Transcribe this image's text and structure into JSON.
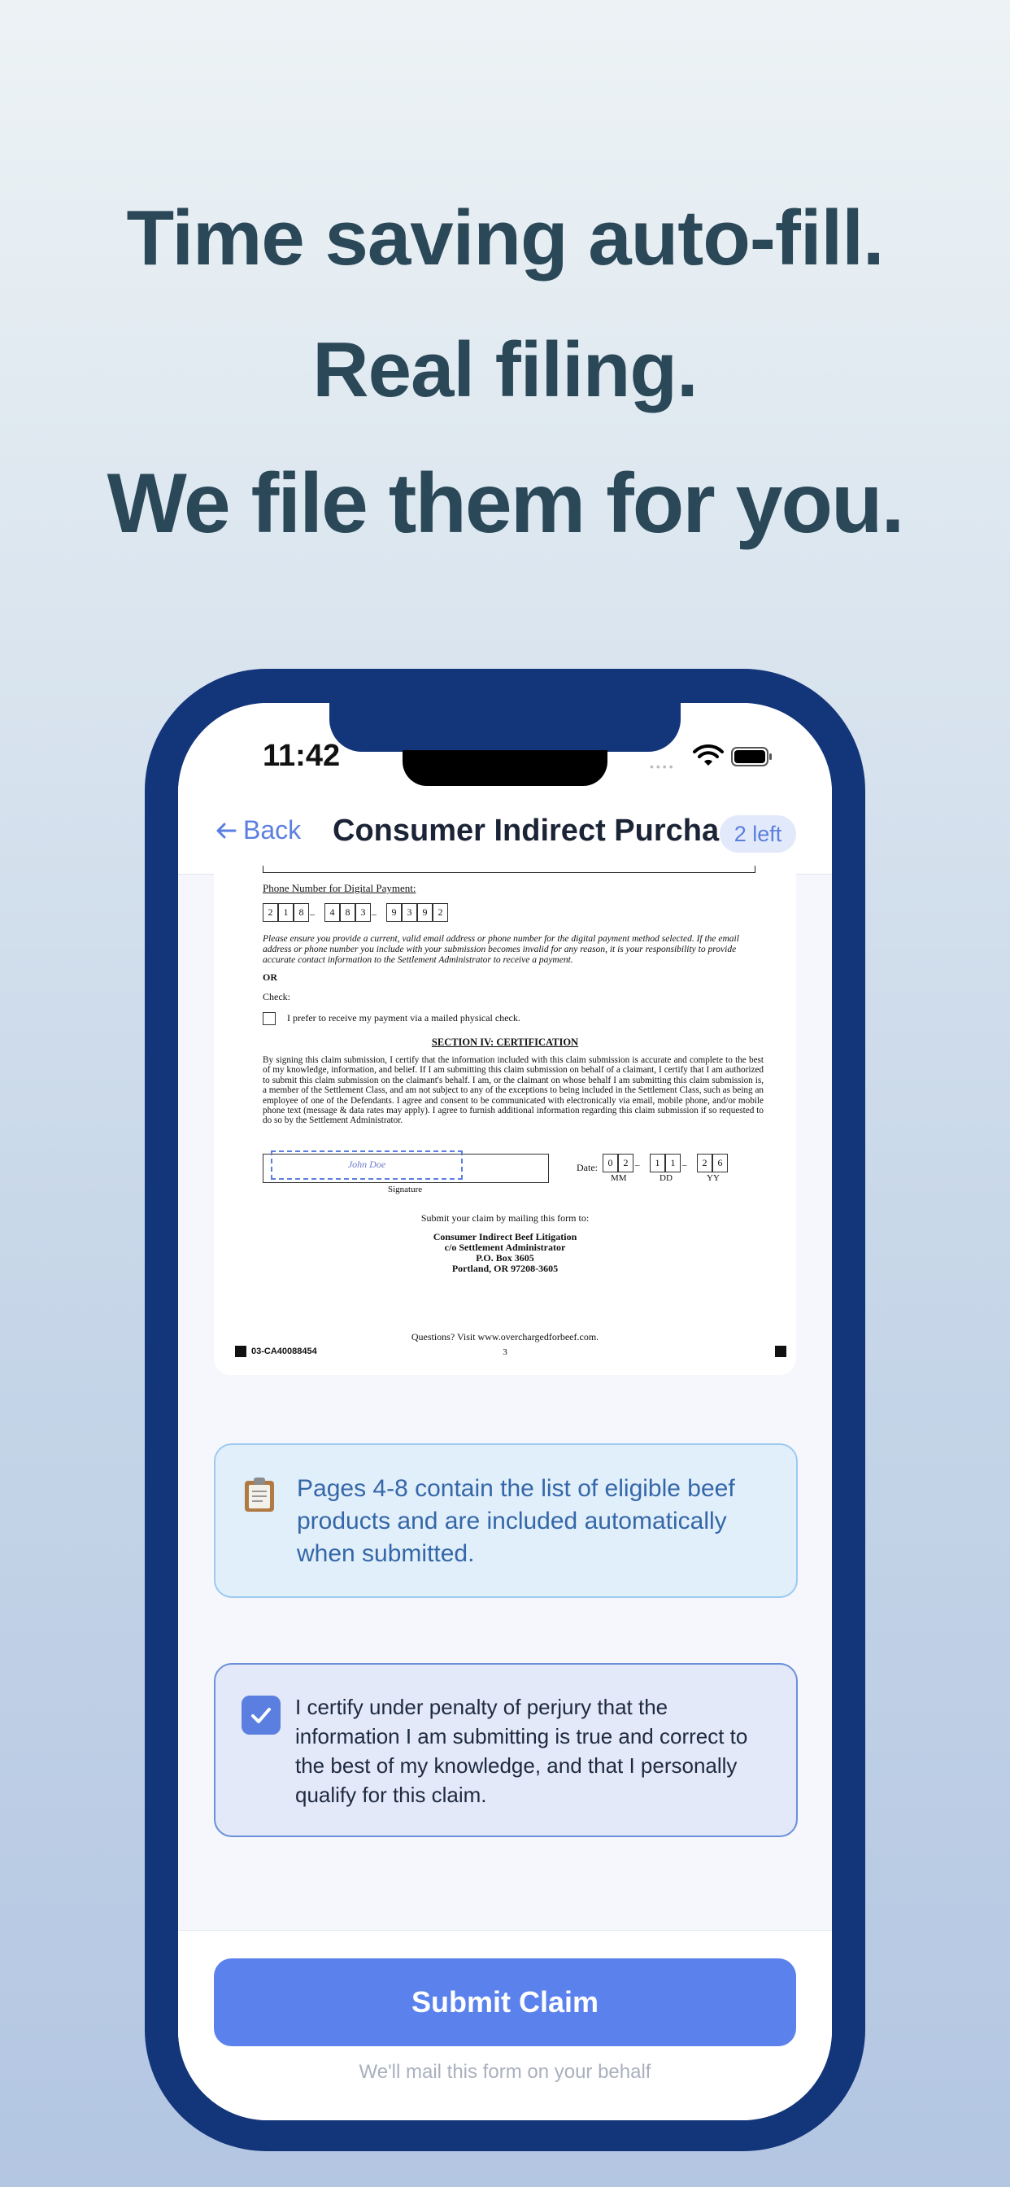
{
  "headline": {
    "line1": "Time saving auto-fill.",
    "line2": "Real filing.",
    "line3": "We file them for you."
  },
  "status_bar": {
    "time": "11:42",
    "signal_dots": "••••"
  },
  "nav": {
    "back_label": "Back",
    "title": "Consumer Indirect Purcha...",
    "badge": "2 left"
  },
  "document": {
    "phone_label": "Phone Number for Digital Payment:",
    "phone_digits_1": [
      "2",
      "1",
      "8"
    ],
    "phone_digits_2": [
      "4",
      "8",
      "3"
    ],
    "phone_digits_3": [
      "9",
      "3",
      "9",
      "2"
    ],
    "dash": "–",
    "notice": "Please ensure you provide a current, valid email address or phone number for the digital payment method selected. If the email address or phone number you include with your submission becomes invalid for any reason, it is your responsibility to provide accurate contact information to the Settlement Administrator to receive a payment.",
    "or": "OR",
    "check": "Check:",
    "check_option": "I prefer to receive my payment via a mailed physical check.",
    "section_title": "SECTION IV: CERTIFICATION",
    "certification_body": "By signing this claim submission, I certify that the information included with this claim submission is accurate and complete to the best of my knowledge, information, and belief. If I am submitting this claim submission on behalf of a claimant, I certify that I am authorized to submit this claim submission on the claimant's behalf. I am, or the claimant on whose behalf I am submitting this claim submission is, a member of the Settlement Class, and am not subject to any of the exceptions to being included in the Settlement Class, such as being an employee of one of the Defendants. I agree and consent to be communicated with electronically via email, mobile phone, and/or mobile phone text (message & data rates may apply). I agree to furnish additional information regarding this claim submission if so requested to do so by the Settlement Administrator.",
    "signature_name": "John Doe",
    "signature_label": "Signature",
    "date_label": "Date:",
    "date_mm": [
      "0",
      "2"
    ],
    "date_dd": [
      "1",
      "1"
    ],
    "date_yy": [
      "2",
      "6"
    ],
    "mm": "MM",
    "dd": "DD",
    "yy": "YY",
    "mail_instruction": "Submit your claim by mailing this form to:",
    "address_lines": [
      "Consumer Indirect Beef Litigation",
      "c/o Settlement Administrator",
      "P.O. Box 3605",
      "Portland, OR 97208-3605"
    ],
    "questions": "Questions? Visit www.overchargedforbeef.com.",
    "page_number": "3",
    "claim_code": "03-CA40088454"
  },
  "info_card": {
    "icon": "clipboard-icon",
    "text": "Pages 4-8 contain the list of eligible beef products and are included automatically when submitted."
  },
  "certify": {
    "checked": true,
    "text": "I certify under penalty of perjury that the information I am submitting is true and correct to the best of my knowledge, and that I personally qualify for this claim."
  },
  "submit": {
    "label": "Submit Claim",
    "note": "We'll mail this form on your behalf"
  },
  "colors": {
    "accent": "#5b82ec",
    "frame": "#13357a",
    "headline": "#2b4858",
    "info_bg": "#e1effb",
    "info_text": "#3567a8"
  }
}
